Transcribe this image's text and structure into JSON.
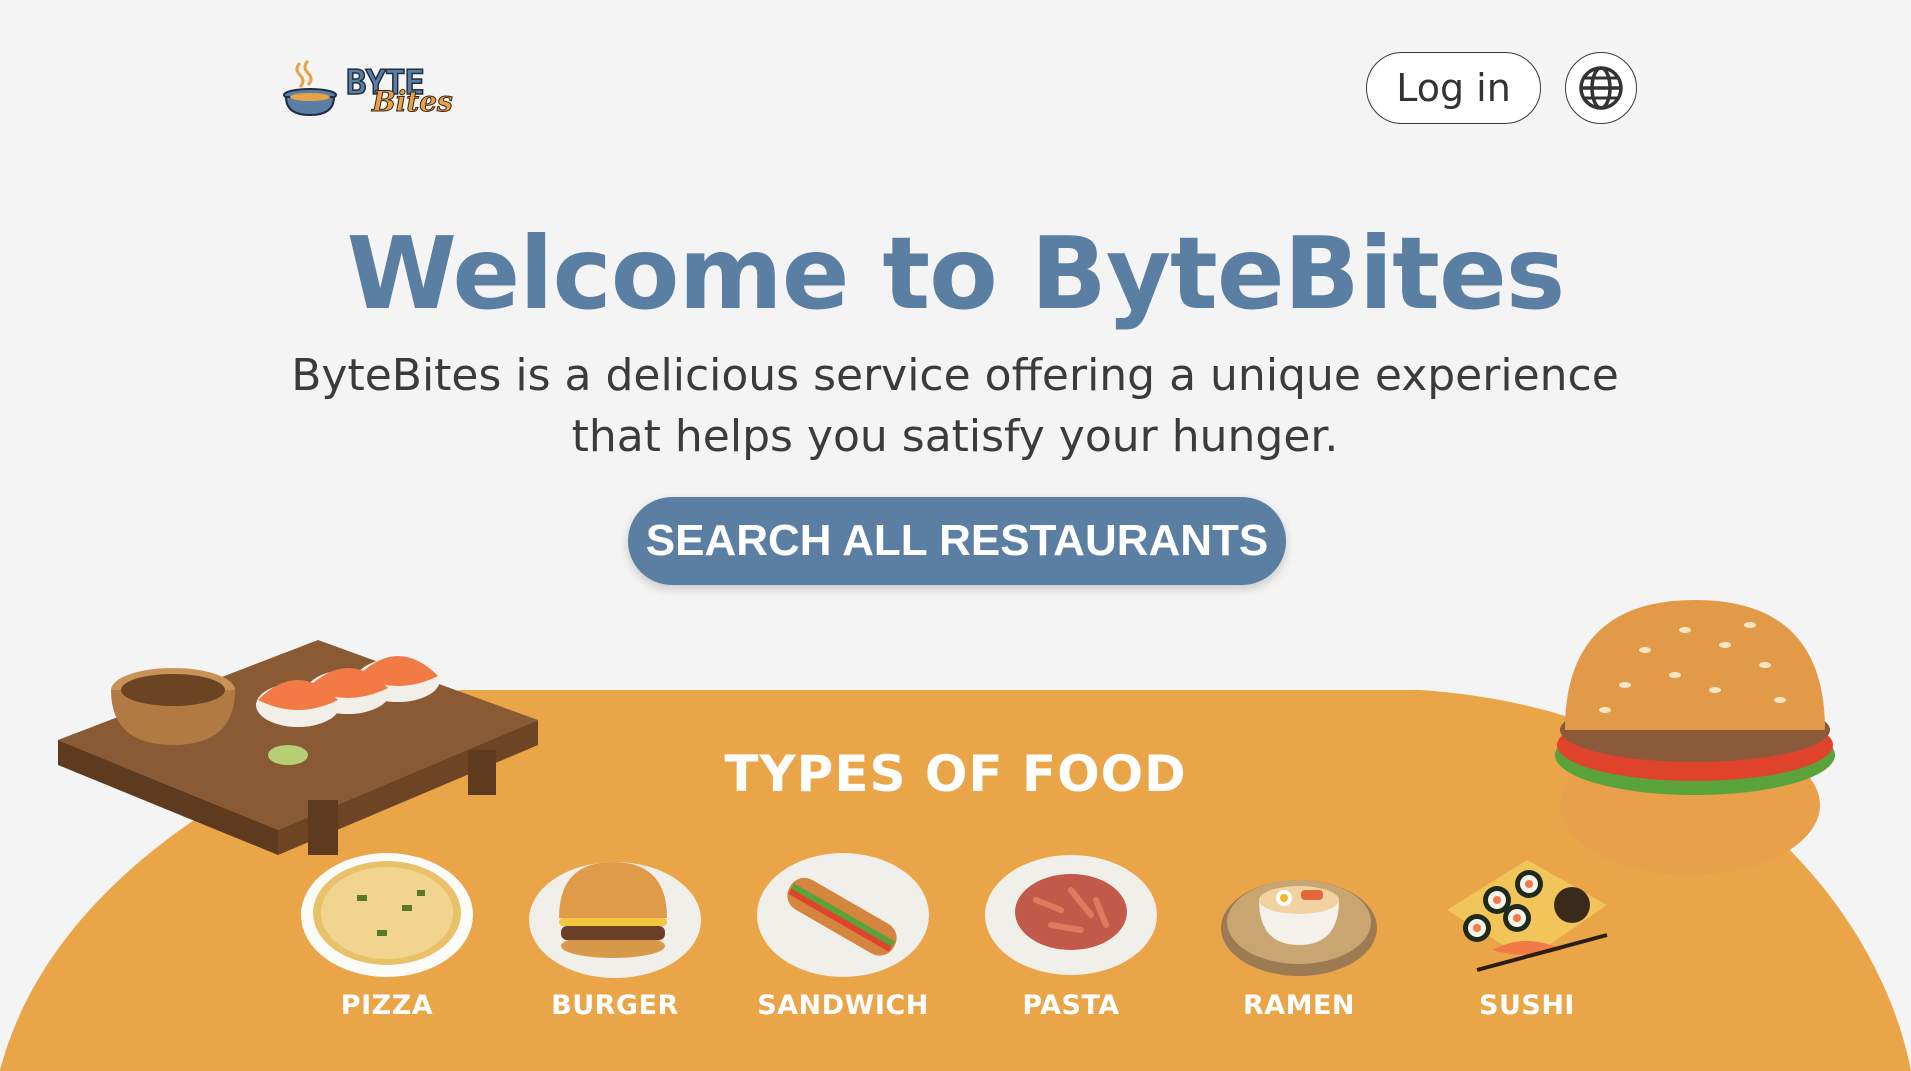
{
  "header": {
    "logo": {
      "line1": "BYTE",
      "line2": "Bites"
    },
    "login_label": "Log in",
    "language_icon": "globe-icon"
  },
  "hero": {
    "title": "Welcome to ByteBites",
    "description": "ByteBites is a delicious service offering a unique experience that helps you satisfy your hunger.",
    "search_button": "SEARCH ALL RESTAURANTS"
  },
  "food_section": {
    "title": "TYPES OF FOOD",
    "items": [
      {
        "label": "PIZZA",
        "icon": "pizza-icon"
      },
      {
        "label": "BURGER",
        "icon": "burger-icon"
      },
      {
        "label": "SANDWICH",
        "icon": "sandwich-icon"
      },
      {
        "label": "PASTA",
        "icon": "pasta-icon"
      },
      {
        "label": "RAMEN",
        "icon": "ramen-icon"
      },
      {
        "label": "SUSHI",
        "icon": "sushi-icon"
      }
    ]
  },
  "colors": {
    "background": "#f4f4f4",
    "primary_blue": "#5b7fa3",
    "accent_orange": "#eba549",
    "text_dark": "#3b3b3b"
  }
}
